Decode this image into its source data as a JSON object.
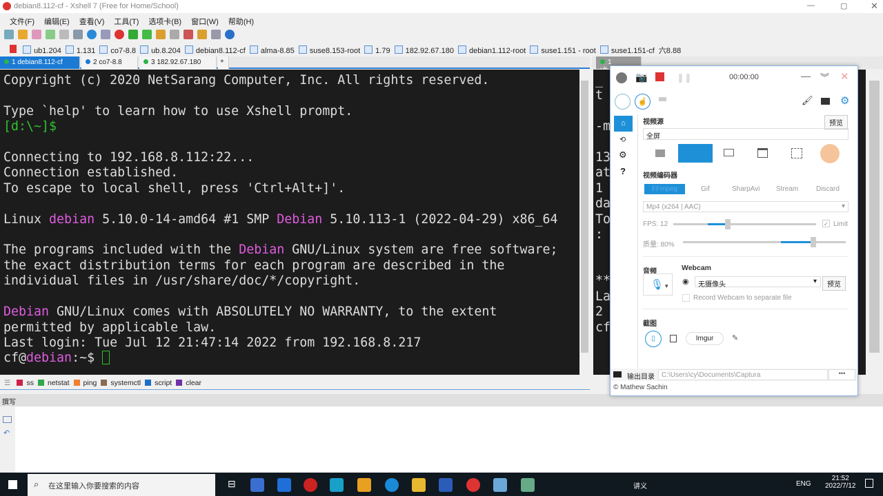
{
  "window": {
    "title": "debian8.112-cf - Xshell 7 (Free for Home/School)"
  },
  "menu": [
    "文件(F)",
    "编辑(E)",
    "查看(V)",
    "工具(T)",
    "选项卡(B)",
    "窗口(W)",
    "帮助(H)"
  ],
  "links": [
    "ub1.204",
    "1.131",
    "co7-8.8",
    "ub.8.204",
    "debian8.112-cf",
    "alma-8.85",
    "suse8.153-root",
    "1.79",
    "182.92.67.180",
    "debian1.112-root",
    "suse1.151 - root",
    "suse1.151-cf",
    "六8.88"
  ],
  "tabs": [
    {
      "label": "1 debian8.112-cf",
      "active": true,
      "status": "connected"
    },
    {
      "label": "2 co7-8.8",
      "status": "warning"
    },
    {
      "label": "3 182.92.67.180",
      "status": "connected"
    }
  ],
  "right_tab": {
    "label": "1 ub.8.204"
  },
  "terminal": {
    "l1": "Copyright (c) 2020 NetSarang Computer, Inc. All rights reserved.",
    "l2": "Type `help' to learn how to use Xshell prompt.",
    "l3": "[d:\\~]$",
    "l4": "Connecting to 192.168.8.112:22...",
    "l5": "Connection established.",
    "l6": "To escape to local shell, press 'Ctrl+Alt+]'.",
    "l7a": "Linux ",
    "l7b": "debian",
    "l7c": " 5.10.0-14-amd64 #1 SMP ",
    "l7d": "Debian",
    "l7e": " 5.10.113-1 (2022-04-29) x86_64",
    "l8a": "The programs included with the ",
    "l8b": "Debian",
    "l8c": " GNU/Linux system are free software;",
    "l9": "the exact distribution terms for each program are described in the",
    "l10": "individual files in /usr/share/doc/*/copyright.",
    "l11a": "Debian",
    "l11b": " GNU/Linux comes with ABSOLUTELY NO WARRANTY, to the extent",
    "l12": "permitted by applicable law.",
    "l13": "Last login: Tue Jul 12 21:47:14 2022 from 192.168.8.217",
    "l14a": "cf@",
    "l14b": "debian",
    "l14c": ":~$ "
  },
  "terminal2": {
    "left": [
      "_",
      "t",
      "",
      "-m",
      "",
      "13",
      "at",
      "1",
      "da",
      "To",
      ":",
      "",
      "",
      "**",
      "La",
      "2",
      "cf"
    ],
    "right": [
      "t",
      "s",
      "i",
      "p",
      "n",
      "2"
    ]
  },
  "quick_commands": [
    {
      "label": "ss",
      "color": "#d0204a"
    },
    {
      "label": "netstat",
      "color": "#2ea84a"
    },
    {
      "label": "ping",
      "color": "#f08030"
    },
    {
      "label": "systemctl",
      "color": "#8a6a50"
    },
    {
      "label": "script",
      "color": "#1e6ec8"
    },
    {
      "label": "clear",
      "color": "#7030a8"
    }
  ],
  "compose": {
    "label": "撰写"
  },
  "captura": {
    "timer": "00:00:00",
    "video_source_label": "视频源",
    "preview": "预览",
    "source_value": "全屏",
    "encoder_label": "视频编码器",
    "encoders": [
      "FFmpeg",
      "Gif",
      "SharpAvi",
      "Stream",
      "Discard"
    ],
    "format": "Mp4 (x264 | AAC)",
    "fps_label": "FPS: 12",
    "fps": 12,
    "fps_fraction": 0.13,
    "limit": "Limit",
    "limit_checked": true,
    "quality_label": "质量: 80%",
    "quality": 80,
    "audio_label": "音频",
    "webcam_label": "Webcam",
    "webcam_value": "无摄像头",
    "webcam_preview": "预览",
    "record_webcam": "Record Webcam to separate file",
    "screenshot_label": "截图",
    "imgur": "Imgur",
    "output_label": "输出目录",
    "output_path": "C:\\Users\\cy\\Documents\\Captura",
    "more": "•••",
    "credit": "© Mathew Sachin",
    "accent": "#1e90d8"
  },
  "taskbar": {
    "search_placeholder": "在这里输入你要搜索的内容",
    "ime": "讲义",
    "lang": "ENG",
    "time": "21:52",
    "date": "2022/7/12"
  }
}
